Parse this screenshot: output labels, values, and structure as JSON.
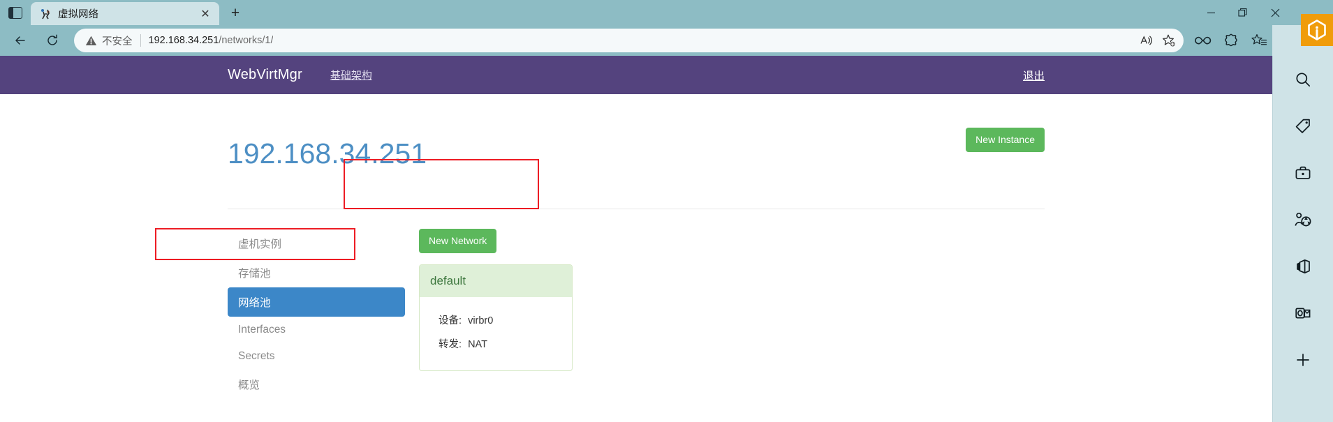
{
  "browser": {
    "tab": {
      "title": "虚拟网络",
      "favicon_name": "virtual-network-favicon",
      "close_label": "✕"
    },
    "new_tab_label": "+",
    "window_controls": {
      "minimize": "—",
      "restore": "❐",
      "close": "✕"
    },
    "nav": {
      "back": "←",
      "reload": "⟳"
    },
    "omnibox": {
      "security_label": "不安全",
      "url_host": "192.168.34.251",
      "url_path": "/networks/1/",
      "read_aloud_title": "A",
      "favorite_title": "☆"
    },
    "toolbar_icons": [
      "copilot-icon",
      "browser-essentials-icon",
      "favorites-icon",
      "collections-icon",
      "profile-avatar-icon"
    ],
    "rail_icons": [
      "search-icon",
      "tag-icon",
      "briefcase-icon",
      "games-icon",
      "office-icon",
      "outlook-icon",
      "add-icon"
    ],
    "brand_badge_name": "edge-drop-badge"
  },
  "site": {
    "navbar": {
      "brand": "WebVirtMgr",
      "links": [
        "基础架构"
      ],
      "logout": "退出"
    },
    "page_title": "192.168.34.251",
    "new_instance_label": "New Instance",
    "sidebar": {
      "items": [
        {
          "label": "虚机实例",
          "active": false
        },
        {
          "label": "存储池",
          "active": false
        },
        {
          "label": "网络池",
          "active": true
        },
        {
          "label": "Interfaces",
          "active": false
        },
        {
          "label": "Secrets",
          "active": false
        },
        {
          "label": "概览",
          "active": false
        }
      ]
    },
    "main": {
      "new_network_label": "New Network",
      "networks": [
        {
          "name": "default",
          "fields": [
            {
              "label": "设备:",
              "value": "virbr0"
            },
            {
              "label": "转发:",
              "value": "NAT"
            }
          ]
        }
      ]
    },
    "colors": {
      "navbar": "#54437e",
      "title": "#4d8fc4",
      "success": "#5cb85c",
      "active_item": "#3c87c8",
      "panel_head": "#dff0d8",
      "annotation": "#ed1c24"
    }
  }
}
